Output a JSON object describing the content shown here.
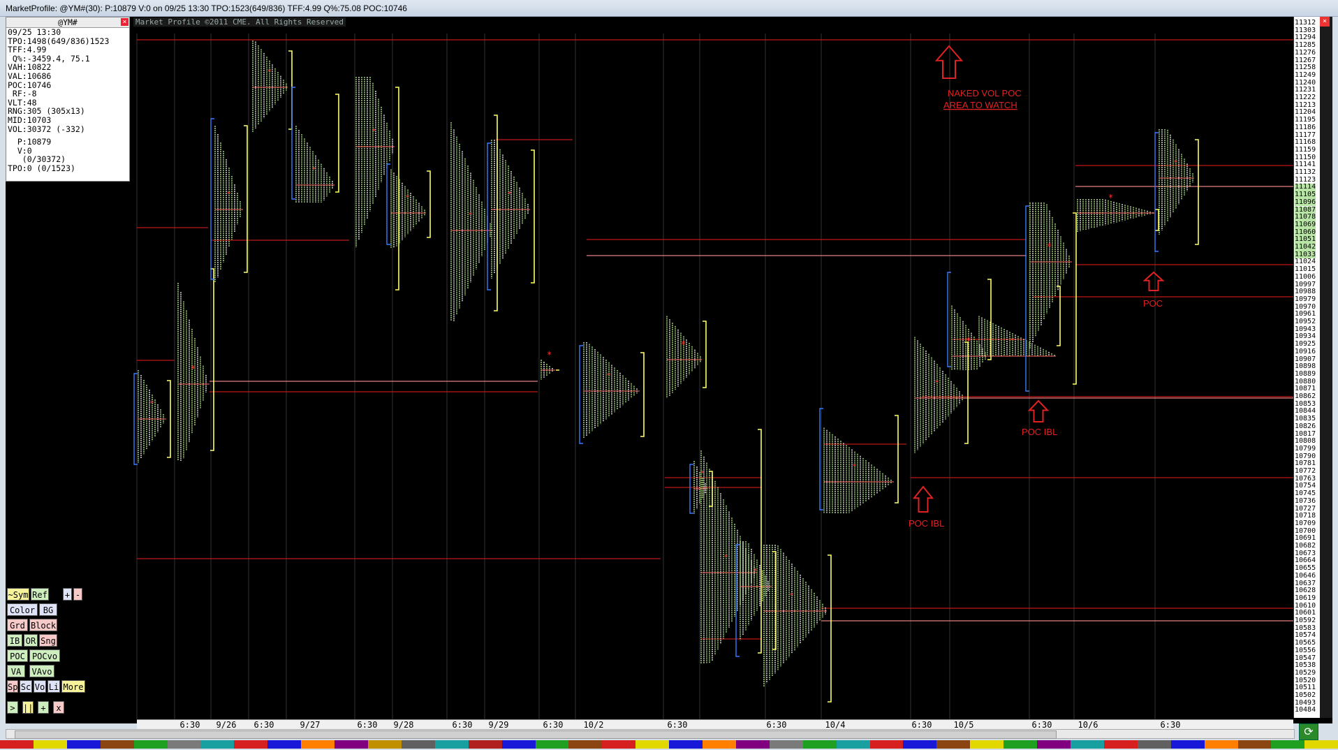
{
  "window": {
    "title": "MarketProfile: @YM#(30): P:10879 V:0 on 09/25 13:30  TPO:1523(649/836)  TFF:4.99  Q%:75.08  POC:10746"
  },
  "copyright": "Market Profile ©2011 CME. All Rights Reserved",
  "info_panel": {
    "symbol": "@YM#",
    "lines": [
      "09/25 13:30",
      "TPO:1498(649/836)1523",
      "TFF:4.99",
      " Q%:-3459.4, 75.1",
      "VAH:10822",
      "VAL:10686",
      "POC:10746",
      " RF:-8",
      "VLT:48",
      "RNG:305 (305x13)",
      "MID:10703",
      "VOL:30372 (-332)"
    ],
    "lines2": [
      "  P:10879",
      "  V:0",
      "   (0/30372)",
      "TPO:0 (0/1523)"
    ]
  },
  "controls": [
    {
      "label": "~Sym",
      "color": "#f6f39a"
    },
    {
      "label": "Ref",
      "color": "#cfeec0"
    },
    {
      "label": "+",
      "color": "#dfe3f7"
    },
    {
      "label": "-",
      "color": "#f7c9c9"
    },
    {
      "label": "Color",
      "color": "#dfe3f7"
    },
    {
      "label": "BG",
      "color": "#dfe3f7"
    },
    {
      "label": "Grd",
      "color": "#f7c9c9"
    },
    {
      "label": "Block",
      "color": "#f7c9c9"
    },
    {
      "label": "IB",
      "color": "#cfeec0"
    },
    {
      "label": "OR",
      "color": "#cfeec0"
    },
    {
      "label": "Sng",
      "color": "#f7c9c9"
    },
    {
      "label": "POC",
      "color": "#cfeec0"
    },
    {
      "label": "POCvo",
      "color": "#cfeec0"
    },
    {
      "label": "VA",
      "color": "#cfeec0"
    },
    {
      "label": "VAvo",
      "color": "#cfeec0"
    },
    {
      "label": "Sp",
      "color": "#f7c9c9"
    },
    {
      "label": "Sc",
      "color": "#dfe3f7"
    },
    {
      "label": "Vo",
      "color": "#dfe3f7"
    },
    {
      "label": "Li",
      "color": "#dfe3f7"
    },
    {
      "label": "More",
      "color": "#f6f39a"
    },
    {
      "label": ">",
      "color": "#cfeec0"
    },
    {
      "label": "||",
      "color": "#f6f39a"
    },
    {
      "label": "+",
      "color": "#cfeec0"
    },
    {
      "label": "x",
      "color": "#f7c9c9"
    }
  ],
  "price_axis": {
    "top_price": 11312,
    "step": 9,
    "count": 93,
    "highlight_range": [
      11033,
      11114
    ]
  },
  "date_axis": [
    "6:30",
    "9/26",
    "6:30",
    "9/27",
    "6:30",
    "9/28",
    "6:30",
    "9/29",
    "6:30",
    "10/2",
    "6:30",
    "6:30",
    "10/4",
    "6:30",
    "10/5",
    "6:30",
    "10/6",
    "6:30"
  ],
  "annotations": {
    "naked_line1": "NAKED VOL POC",
    "naked_line2": " AREA TO WATCH",
    "poc_ibl_1": "POC IBL",
    "poc_ibl_2": "POC IBL",
    "poc": "POC"
  },
  "colors": {
    "background": "#000000",
    "poc_line": "#c01818",
    "annotation": "#e02222",
    "tpo_green": "#a8e07a",
    "tpo_white": "#e8e8e8",
    "bracket_yellow": "#ffff66",
    "bracket_blue": "#3a7aff"
  },
  "color_bar": [
    "#d62020",
    "#e0d800",
    "#1818d8",
    "#8b4513",
    "#20a020",
    "#7a7a7a",
    "#18a0a0",
    "#d62020",
    "#1818d8",
    "#ff7f00",
    "#800080",
    "#c09000",
    "#606060",
    "#18a0a0",
    "#b02020",
    "#1818d8",
    "#20a020",
    "#8b4513",
    "#d62020",
    "#e0d800",
    "#1818d8",
    "#ff7f00",
    "#800080",
    "#7a7a7a",
    "#20a020",
    "#18a0a0",
    "#d62020",
    "#1818d8",
    "#8b4513",
    "#e0d800",
    "#20a020",
    "#800080",
    "#18a0a0",
    "#d62020",
    "#606060",
    "#1818d8",
    "#ff7f00",
    "#8b4513",
    "#20a020",
    "#e0d800"
  ]
}
